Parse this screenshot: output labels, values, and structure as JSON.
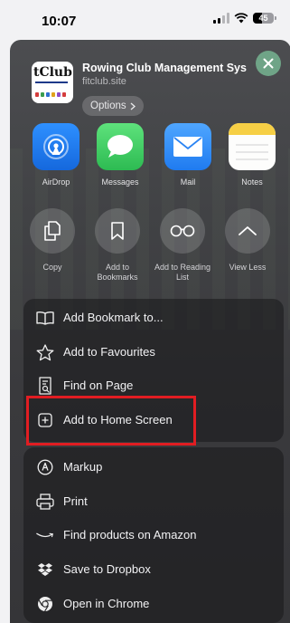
{
  "status": {
    "time": "10:07",
    "battery": "45",
    "battery_level": 0.45
  },
  "site": {
    "title": "Rowing Club Management Syst...",
    "host": "fitclub.site",
    "options_label": "Options",
    "thumb_brand": "tClub"
  },
  "apps": [
    {
      "label": "AirDrop",
      "icon": "airdrop-icon"
    },
    {
      "label": "Messages",
      "icon": "messages-icon"
    },
    {
      "label": "Mail",
      "icon": "mail-icon"
    },
    {
      "label": "Notes",
      "icon": "notes-icon"
    }
  ],
  "actions": [
    {
      "label": "Copy",
      "icon": "copy-icon"
    },
    {
      "label": "Add to Bookmarks",
      "icon": "bookmark-icon"
    },
    {
      "label": "Add to Reading List",
      "icon": "reading-list-icon"
    },
    {
      "label": "View Less",
      "icon": "chevron-up-icon"
    }
  ],
  "menu_primary": [
    {
      "label": "Add Bookmark to...",
      "icon": "book-icon"
    },
    {
      "label": "Add to Favourites",
      "icon": "star-icon"
    },
    {
      "label": "Find on Page",
      "icon": "find-icon"
    },
    {
      "label": "Add to Home Screen",
      "icon": "plus-square-icon"
    }
  ],
  "menu_secondary": [
    {
      "label": "Markup",
      "icon": "markup-icon"
    },
    {
      "label": "Print",
      "icon": "printer-icon"
    },
    {
      "label": "Find products on Amazon",
      "icon": "amazon-icon"
    },
    {
      "label": "Save to Dropbox",
      "icon": "dropbox-icon"
    },
    {
      "label": "Open in Chrome",
      "icon": "chrome-icon"
    }
  ],
  "colors": {
    "highlight": "#e11d22",
    "close_button": "#6fa487",
    "airdrop": "#1a7cf0",
    "messages": "#37c25b",
    "mail": "#2f8af5",
    "notes_band": "#f6cf45"
  }
}
